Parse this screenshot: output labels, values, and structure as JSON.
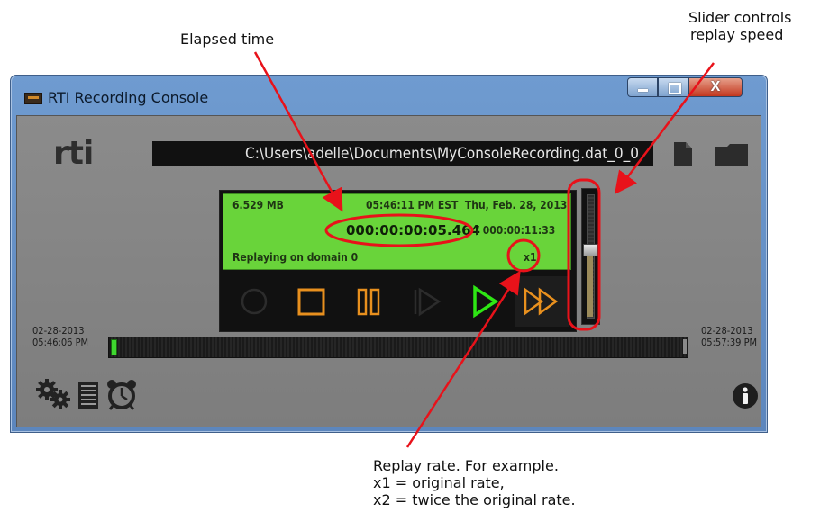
{
  "callouts": {
    "elapsed": "Elapsed time",
    "slider_line1": "Slider controls",
    "slider_line2": "replay speed",
    "rate_line1": "Replay rate. For example.",
    "rate_line2": "x1 = original rate,",
    "rate_line3": "x2 = twice the original rate."
  },
  "window": {
    "title": "RTI Recording Console",
    "close_label": "X"
  },
  "header": {
    "logo": "rti",
    "file_path": "C:\\Users\\adelle\\Documents\\MyConsoleRecording.dat_0_0"
  },
  "display": {
    "size": "6.529 MB",
    "datetime": "05:46:11 PM EST  Thu, Feb. 28, 2013",
    "elapsed": "000:00:00:05.464",
    "total": "/ 000:00:11:33",
    "status": "Replaying on domain 0",
    "rate": "x1"
  },
  "controls": [
    "record-button",
    "stop-button",
    "pause-button",
    "step-button",
    "play-button",
    "fast-forward-button"
  ],
  "speed_slider": {
    "level": 0.55
  },
  "timeline": {
    "start_date": "02-28-2013",
    "start_time": "05:46:06 PM",
    "end_date": "02-28-2013",
    "end_time": "05:57:39 PM"
  },
  "colors": {
    "annotation": "#e8121a",
    "lcd": "#69d43a",
    "play": "#2ee614",
    "control_orange": "#e8901e"
  },
  "icons": [
    "settings-gears-icon",
    "log-list-icon",
    "alarm-clock-icon",
    "info-icon",
    "file-icon",
    "folder-icon"
  ]
}
